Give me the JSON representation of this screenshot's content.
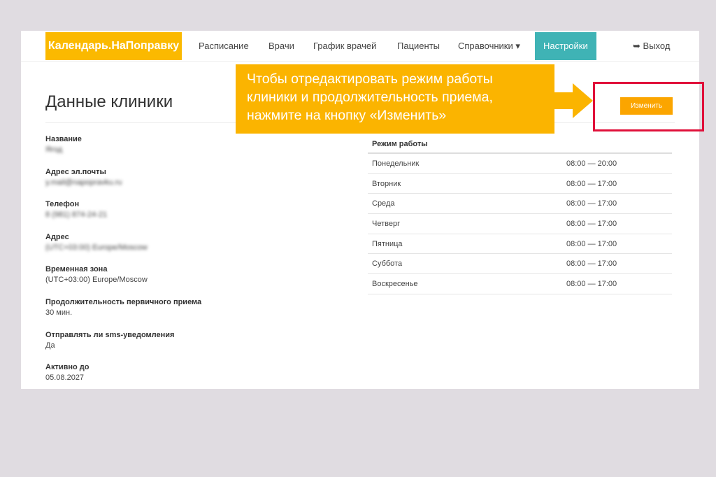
{
  "nav": {
    "logo": "Календарь.НаПоправку",
    "items": [
      "Расписание",
      "Врачи",
      "График врачей",
      "Пациенты",
      "Справочники ▾",
      "Настройки"
    ],
    "logout": "Выход"
  },
  "page": {
    "title": "Данные клиники",
    "edit_button": "Изменить"
  },
  "fields": [
    {
      "label": "Название",
      "value": "Ягод",
      "blurred": true
    },
    {
      "label": "Адрес эл.почты",
      "value": "y.mail@napopravku.ru",
      "blurred": true
    },
    {
      "label": "Телефон",
      "value": "8 (981) 874-24-21",
      "blurred": true
    },
    {
      "label": "Адрес",
      "value": "(UTC+03:00) Europe/Moscow",
      "blurred": true
    },
    {
      "label": "Временная зона",
      "value": "(UTC+03:00) Europe/Moscow"
    },
    {
      "label": "Продолжительность первичного приема",
      "value": "30 мин."
    },
    {
      "label": "Отправлять ли sms-уведомления",
      "value": "Да"
    },
    {
      "label": "Активно до",
      "value": "05.08.2027"
    }
  ],
  "schedule": {
    "header": "Режим работы",
    "rows": [
      {
        "day": "Понедельник",
        "time": "08:00 — 20:00"
      },
      {
        "day": "Вторник",
        "time": "08:00 — 17:00"
      },
      {
        "day": "Среда",
        "time": "08:00 — 17:00"
      },
      {
        "day": "Четверг",
        "time": "08:00 — 17:00"
      },
      {
        "day": "Пятница",
        "time": "08:00 — 17:00"
      },
      {
        "day": "Суббота",
        "time": "08:00 — 17:00"
      },
      {
        "day": "Воскресенье",
        "time": "08:00 — 17:00"
      }
    ]
  },
  "callout": {
    "text": "Чтобы отредактировать режим работы клиники и продолжительность приема, нажмите на кнопку «Изменить»"
  },
  "colors": {
    "brand": "#fbb900",
    "active_tab": "#3fb3b5",
    "highlight": "#e0103a"
  }
}
